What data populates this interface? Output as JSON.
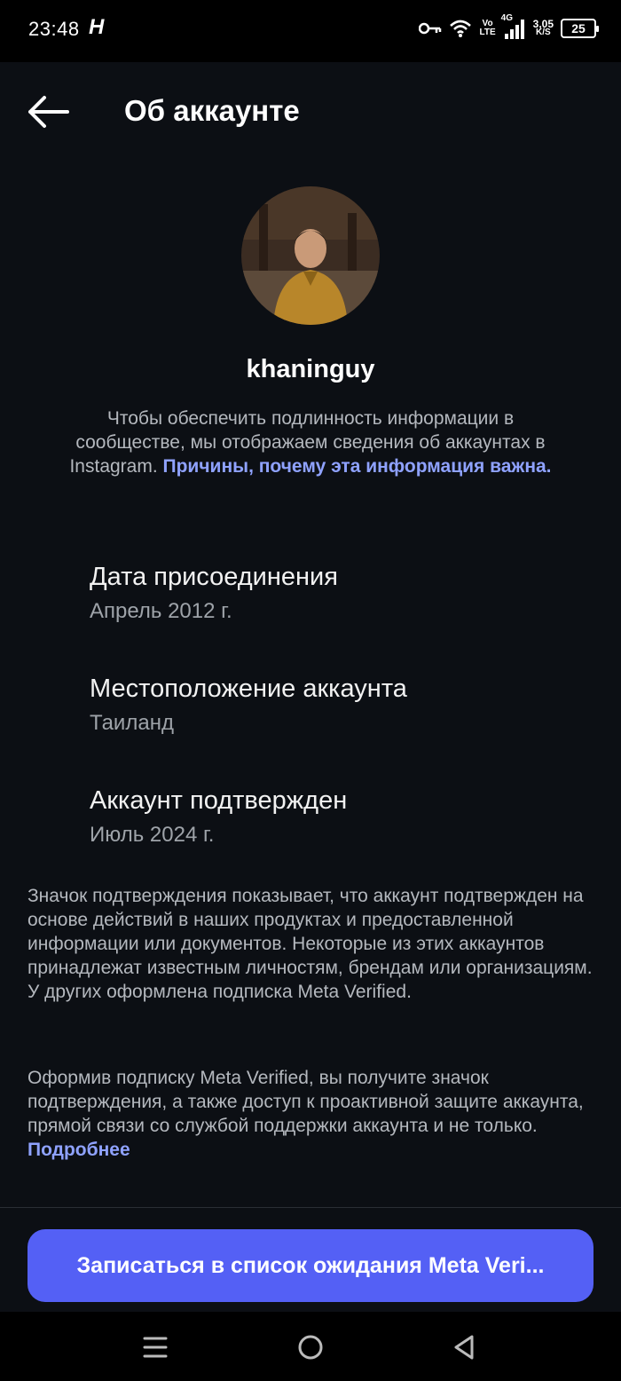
{
  "status_bar": {
    "time": "23:48",
    "app_indicator": "H",
    "network_top": "Vo",
    "network_bottom": "LTE",
    "network_type": "4G",
    "speed_value": "3,05",
    "speed_unit": "K/S",
    "battery": "25",
    "icons": [
      "key-icon",
      "wifi-icon",
      "signal-icon",
      "battery-icon"
    ]
  },
  "header": {
    "title": "Об аккаунте",
    "back_icon": "arrow-left-icon"
  },
  "profile": {
    "username": "khaninguy",
    "intro_text": "Чтобы обеспечить подлинность информации в сообществе, мы отображаем сведения об аккаунтах в Instagram. ",
    "intro_link": "Причины, почему эта информация важна."
  },
  "details": [
    {
      "label": "Дата присоединения",
      "value": "Апрель 2012 г."
    },
    {
      "label": "Местоположение аккаунта",
      "value": "Таиланд"
    },
    {
      "label": "Аккаунт подтвержден",
      "value": "Июль 2024 г."
    }
  ],
  "verification_text": "Значок подтверждения показывает, что аккаунт подтвержден на основе действий в наших продуктах и предоставленной информации или документов. Некоторые из этих аккаунтов принадлежат известным личностям, брендам или организациям. У других оформлена подписка Meta Verified.",
  "meta_text": "Оформив подписку Meta Verified, вы получите значок подтверждения, а также доступ к проактивной защите аккаунта, прямой связи со службой поддержки аккаунта и не только. ",
  "meta_link": "Подробнее",
  "waitlist_button": "Записаться в список ожидания Meta Veri...",
  "nav_bar": {
    "icons": [
      "menu-icon",
      "home-icon",
      "back-triangle-icon"
    ]
  },
  "colors": {
    "background": "#0c0f14",
    "link": "#8fa2ff",
    "button": "#5460f5"
  }
}
